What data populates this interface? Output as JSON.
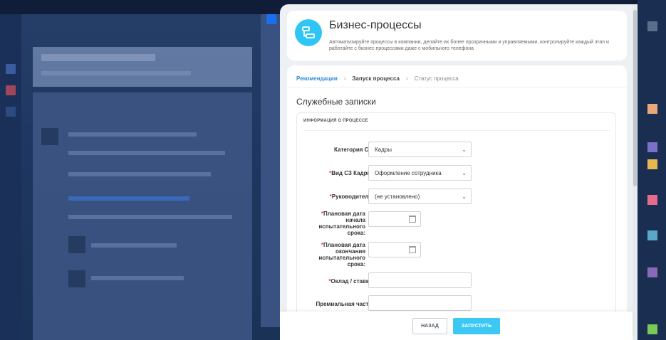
{
  "header": {
    "title": "Бизнес-процессы",
    "description": "Автоматизируйте процессы в компании, делайте их более прозрачными и управляемыми, контролируйте каждый этап и работайте с бизнес-процессами даже с мобильного телефона"
  },
  "steps": [
    {
      "label": "Рекомендации",
      "state": "done"
    },
    {
      "label": "Запуск процесса",
      "state": "current"
    },
    {
      "label": "Статус процесса",
      "state": "future"
    }
  ],
  "section_title": "Служебные записки",
  "form": {
    "section_header": "ИНФОРМАЦИЯ О ПРОЦЕССЕ",
    "fields": [
      {
        "label": "Категория СЗ:",
        "required": false,
        "type": "select",
        "value": "Кадры"
      },
      {
        "label": "Вид СЗ Кадры:",
        "required": true,
        "type": "select",
        "value": "Оформление сотрудника"
      },
      {
        "label": "Руководитель:",
        "required": true,
        "type": "select",
        "value": "(не установлено)"
      },
      {
        "label": "Плановая дата начала испытательного срока:",
        "required": true,
        "type": "date",
        "value": ""
      },
      {
        "label": "Плановая дата окончания испытательного срока:",
        "required": true,
        "type": "date",
        "value": ""
      },
      {
        "label": "Оклад / ставка:",
        "required": true,
        "type": "text",
        "value": ""
      },
      {
        "label": "Премиальная часть:",
        "required": false,
        "type": "text",
        "value": ""
      }
    ]
  },
  "footer": {
    "back_label": "НАЗАД",
    "run_label": "ЗАПУСТИТЬ"
  },
  "required_mark": "*",
  "colors": {
    "accent": "#2fc6f6",
    "run_button": "#3bc8f5",
    "step_active": "#2d8fd5",
    "required": "#ee3333"
  }
}
